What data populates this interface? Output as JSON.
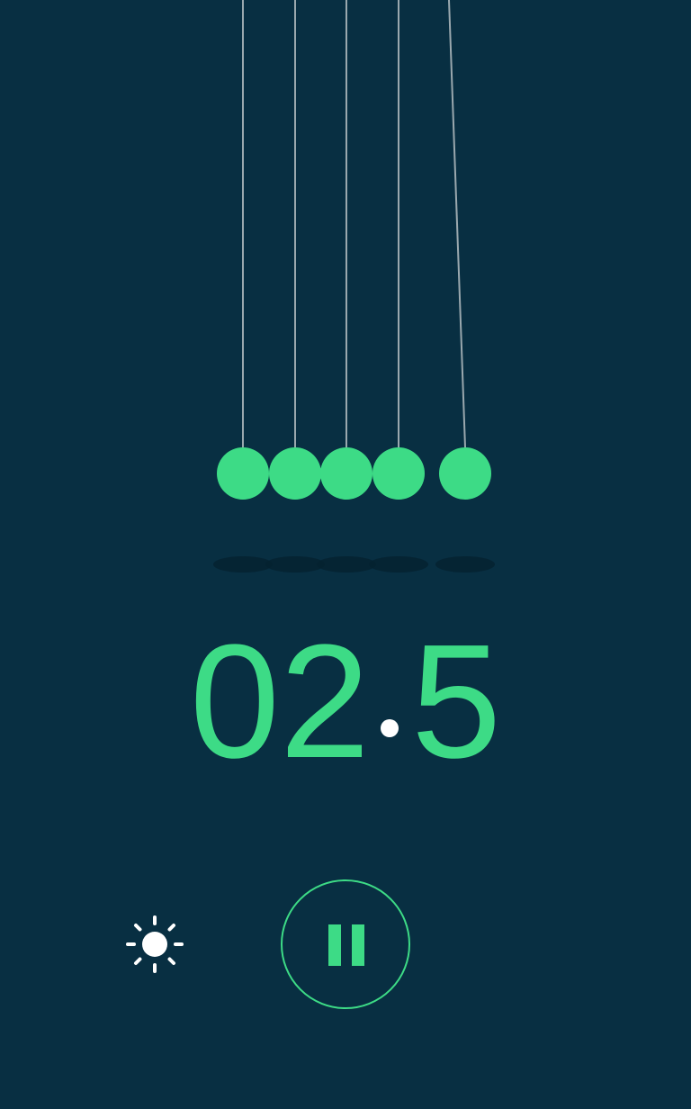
{
  "colors": {
    "background": "#082f42",
    "ball": "#3ddb86",
    "string": "#9aa8ae",
    "shadow": "#052230",
    "accent": "#3ddb86",
    "icon": "#ffffff"
  },
  "cradle": {
    "ball_count": 5,
    "swinging_ball_index": 4
  },
  "timer": {
    "whole": "02",
    "fraction": "5"
  },
  "controls": {
    "brightness_icon": "sun-icon",
    "pause_icon": "pause-icon"
  }
}
